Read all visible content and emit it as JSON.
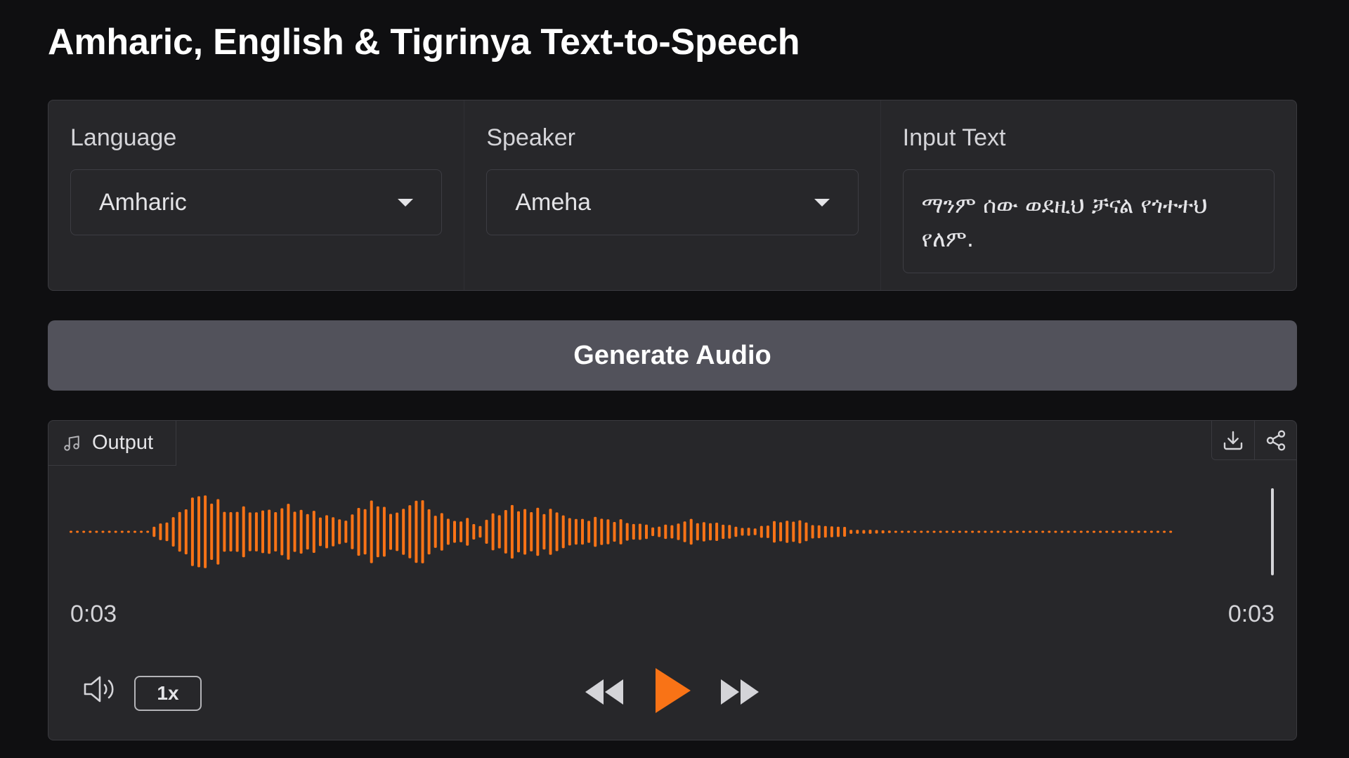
{
  "title": "Amharic, English & Tigrinya Text-to-Speech",
  "form": {
    "language": {
      "label": "Language",
      "value": "Amharic"
    },
    "speaker": {
      "label": "Speaker",
      "value": "Ameha"
    },
    "input_text": {
      "label": "Input Text",
      "value": "ማንም ሰው ወደዚህ ቻናል የጎተተህ የለም."
    }
  },
  "generate_button": "Generate Audio",
  "output": {
    "tab_label": "Output",
    "icons": {
      "tab": "music-note-icon",
      "download": "download-icon",
      "share": "share-icon",
      "volume": "volume-icon",
      "rewind": "rewind-icon",
      "play": "play-icon",
      "forward": "fast-forward-icon"
    },
    "current_time": "0:03",
    "duration": "0:03",
    "playback_progress": 1.0,
    "speed": "1x"
  },
  "colors": {
    "accent": "#f97316",
    "background": "#0f0f11",
    "panel": "#27272a",
    "button": "#52525b"
  }
}
